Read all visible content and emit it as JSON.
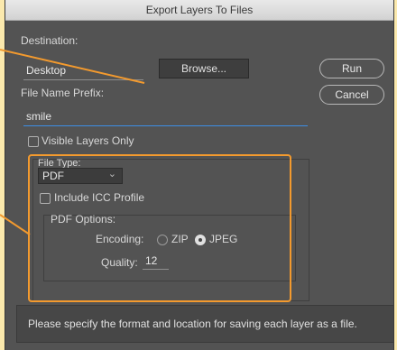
{
  "window": {
    "title": "Export Layers To Files"
  },
  "destination": {
    "label": "Destination:",
    "value": "Desktop",
    "browse_label": "Browse..."
  },
  "prefix": {
    "label": "File Name Prefix:",
    "value": "smile"
  },
  "visible_layers": {
    "label": "Visible Layers Only",
    "checked": false
  },
  "file_type": {
    "label": "File Type:",
    "selected": "PDF",
    "chevron": "⌄"
  },
  "icc": {
    "label": "Include ICC Profile",
    "checked": false
  },
  "pdf_options": {
    "label": "PDF Options:",
    "encoding_label": "Encoding:",
    "zip_label": "ZIP",
    "jpeg_label": "JPEG",
    "selected_encoding": "JPEG",
    "quality_label": "Quality:",
    "quality_value": "12"
  },
  "actions": {
    "run_label": "Run",
    "cancel_label": "Cancel"
  },
  "message": "Please specify the format and location for saving each layer as a file.",
  "colors": {
    "annotation": "#f39a2e",
    "panel": "#535353",
    "focus": "#3c8ee6"
  }
}
